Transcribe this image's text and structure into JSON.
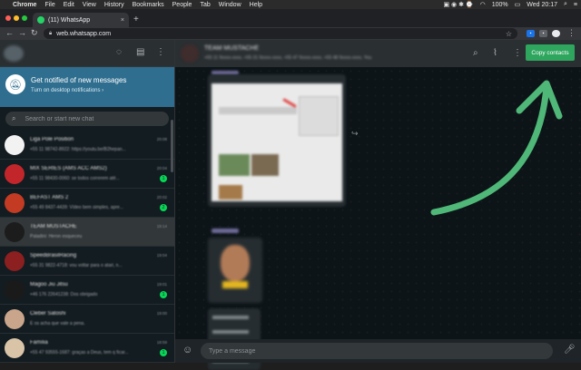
{
  "menubar": {
    "app": "Chrome",
    "items": [
      "File",
      "Edit",
      "View",
      "History",
      "Bookmarks",
      "People",
      "Tab",
      "Window",
      "Help"
    ],
    "battery": "100%",
    "clock": "Wed 20:17"
  },
  "browser": {
    "tab_title": "(11) WhatsApp",
    "tab_close": "×",
    "new_tab": "+",
    "url": "web.whatsapp.com"
  },
  "sidebar": {
    "notification_title": "Get notified of new messages",
    "notification_link": "Turn on desktop notifications ›",
    "search_placeholder": "Search or start new chat",
    "chats": [
      {
        "name": "Liga Pole Position",
        "preview": "+55 11 98742-8922: https://youtu.be/B2hepan...",
        "time": "20:08",
        "badge": "",
        "avatar": "#f2f2f2"
      },
      {
        "name": "MIX SERIES (AMS ACC AMS2)",
        "preview": "+55 11 98430-0060: se todos correrem até...",
        "time": "20:04",
        "badge": "1",
        "avatar": "#c2262b"
      },
      {
        "name": "BEFAST AMS 2",
        "preview": "+55 49 8437-4439: Vídeo bem simples, apre...",
        "time": "20:02",
        "badge": "2",
        "avatar": "#c23b22"
      },
      {
        "name": "TEAM MUSTACHE",
        "preview": "Paladini: Heron esqueceu",
        "time": "19:14",
        "badge": "",
        "avatar": "#1c1c1c"
      },
      {
        "name": "SpeedBrasilRacing",
        "preview": "+55 31 9822-4718: vou voltar para o atari, n...",
        "time": "19:04",
        "badge": "",
        "avatar": "#8c1f1f"
      },
      {
        "name": "Magoo Jiu Jitsu",
        "preview": "+46 176 22641238: Dos obrigado",
        "time": "19:01",
        "badge": "1",
        "avatar": "#1a1a1a"
      },
      {
        "name": "Cleber Satoshi",
        "preview": "É os acha que vale a pena.",
        "time": "19:00",
        "badge": "",
        "avatar": "#c9a58b"
      },
      {
        "name": "Família",
        "preview": "+55 47 93555-1687: graças a Deus, tem q ficar...",
        "time": "18:59",
        "badge": "1",
        "avatar": "#d9c4a8"
      }
    ]
  },
  "conversation": {
    "title": "TEAM MUSTACHE",
    "subtitle": "+55 11 9xxxx-xxxx, +55 31 9xxxx-xxxx, +55 47 9xxxx-xxxx, +55 48 9xxxx-xxxx, You",
    "copy_button": "Copy contacts",
    "composer_placeholder": "Type a message"
  },
  "colors": {
    "accent_green": "#2ea65e",
    "notify_blue": "#2f6e8f",
    "arrow_green": "#4fb777"
  },
  "icons": {
    "status": "status-icon",
    "new_chat": "message-icon",
    "menu": "kebab-menu-icon",
    "search": "search-icon",
    "attach": "paperclip-icon",
    "emoji": "emoji-icon",
    "mic": "microphone-icon"
  }
}
